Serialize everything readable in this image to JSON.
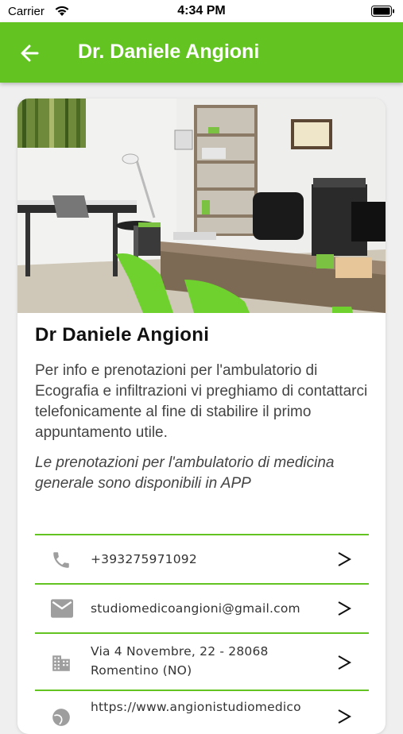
{
  "status_bar": {
    "carrier": "Carrier",
    "time": "4:34 PM"
  },
  "app_bar": {
    "title": "Dr. Daniele Angioni",
    "back_icon": "arrow-back-icon"
  },
  "doctor": {
    "name": "Dr Daniele Angioni",
    "description": "Per info e prenotazioni per l'ambulatorio di Ecografia e infiltrazioni vi preghiamo di contattarci telefonicamente al fine di stabilire il primo appuntamento utile.",
    "note": "Le prenotazioni per l'ambulatorio di medicina generale sono disponibili in APP"
  },
  "contacts": [
    {
      "icon": "phone-icon",
      "lines": [
        "+393275971092"
      ]
    },
    {
      "icon": "mail-icon",
      "lines": [
        "studiomedicoangioni@gmail.com"
      ]
    },
    {
      "icon": "building-icon",
      "lines": [
        "Via 4 Novembre, 22 - 28068",
        "Romentino (NO)"
      ]
    },
    {
      "icon": "globe-icon",
      "lines": [
        "https://www.angionistudiomedico"
      ]
    }
  ],
  "colors": {
    "accent": "#63c321",
    "background": "#efefef",
    "card": "#ffffff"
  }
}
